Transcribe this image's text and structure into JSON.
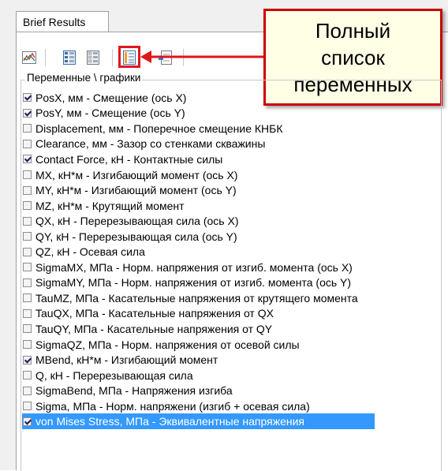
{
  "tab": {
    "label": "Brief Results"
  },
  "toolbar": {
    "icons": [
      "chart-icon",
      "grid-select-icon",
      "grid-deselect-icon",
      "full-list-icon",
      "export-icon"
    ]
  },
  "callout": {
    "lines": [
      "Полный",
      "список",
      "переменных"
    ]
  },
  "group": {
    "title": "Переменные \\ графики"
  },
  "variables": [
    {
      "label": "PosX, мм - Смещение (ось X)",
      "checked": true
    },
    {
      "label": "PosY, мм - Смещение (ось Y)",
      "checked": true
    },
    {
      "label": "Displacement, мм - Поперечное смещение КНБК",
      "checked": false
    },
    {
      "label": "Clearance, мм - Зазор со стенками скважины",
      "checked": false
    },
    {
      "label": "Contact Force, кН - Контактные силы",
      "checked": true
    },
    {
      "label": "MX, кН*м - Изгибающий момент (ось X)",
      "checked": false
    },
    {
      "label": "MY, кН*м - Изгибающий момент (ось Y)",
      "checked": false
    },
    {
      "label": "MZ, кН*м - Крутящий момент",
      "checked": false
    },
    {
      "label": "QX, кН - Перерезывающая сила (ось X)",
      "checked": false
    },
    {
      "label": "QY, кН - Перерезывающая сила (ось Y)",
      "checked": false
    },
    {
      "label": "QZ, кН - Осевая сила",
      "checked": false
    },
    {
      "label": "SigmaMX, МПа - Норм. напряжения от изгиб. момента (ось X)",
      "checked": false
    },
    {
      "label": "SigmaMY, МПа - Норм. напряжения от изгиб. момента (ось Y)",
      "checked": false
    },
    {
      "label": "TauMZ, МПа - Касательные напряжения от крутящего момента",
      "checked": false
    },
    {
      "label": "TauQX, МПа - Касательные напряжения от QX",
      "checked": false
    },
    {
      "label": "TauQY, МПа - Касательные напряжения от QY",
      "checked": false
    },
    {
      "label": "SigmaQZ, МПа - Норм. напряжения от осевой силы",
      "checked": false
    },
    {
      "label": "MBend, кН*м - Изгибающий момент",
      "checked": true
    },
    {
      "label": "Q, кН - Перерезывающая сила",
      "checked": false
    },
    {
      "label": "SigmaBend, МПа - Напряжения изгиба",
      "checked": false
    },
    {
      "label": "Sigma, МПа - Норм. напряжени (изгиб + осевая сила)",
      "checked": false
    },
    {
      "label": "von Mises Stress, МПа - Эквивалентные напряжения",
      "checked": true,
      "selected": true
    }
  ]
}
